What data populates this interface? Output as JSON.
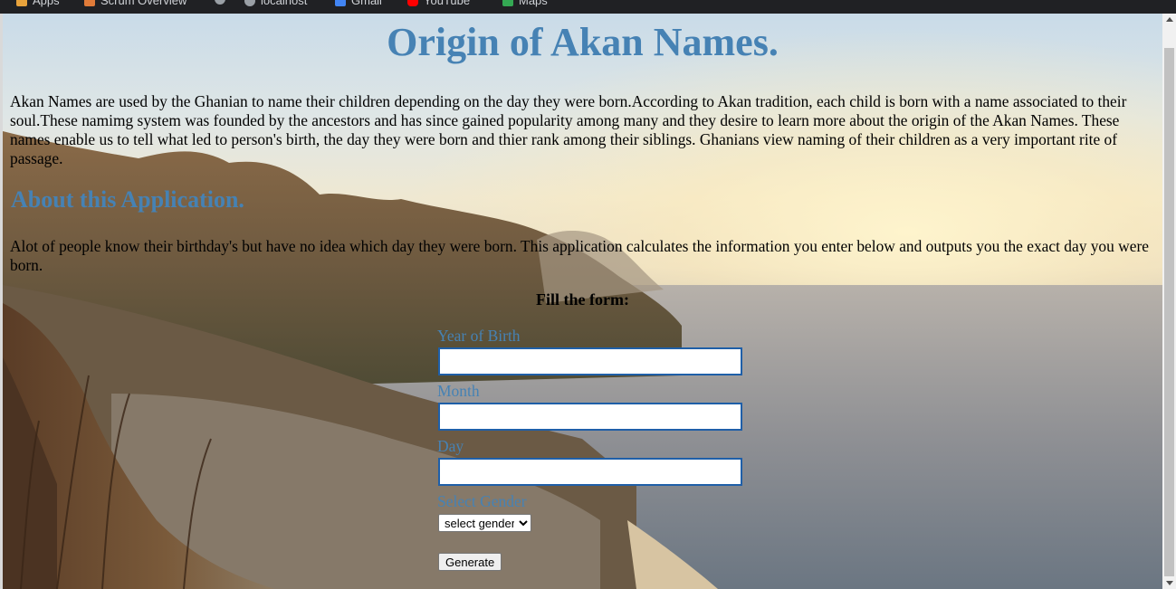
{
  "browser": {
    "bookmarks": [
      {
        "label": "Apps",
        "icon": "apps-grid-icon",
        "color": "#e8a33c"
      },
      {
        "label": "Scrum Overview",
        "icon": "bookmark-page-icon",
        "color": "#e07b39"
      },
      {
        "label": "",
        "icon": "globe-icon",
        "color": "#9aa0a6"
      },
      {
        "label": "localhost",
        "icon": "globe-icon",
        "color": "#9aa0a6"
      },
      {
        "label": "Gmail",
        "icon": "gmail-icon",
        "color": "#4285f4"
      },
      {
        "label": "YouTube",
        "icon": "youtube-icon",
        "color": "#ff0000"
      },
      {
        "label": "Maps",
        "icon": "maps-icon",
        "color": "#34a853"
      }
    ]
  },
  "page": {
    "title": "Origin of Akan Names.",
    "intro": "Akan Names are used by the Ghanian to name their children depending on the day they were born.According to Akan tradition, each child is born with a name associated to their soul.These namimg system was founded by the ancestors and has since gained popularity among many and they desire to learn more about the origin of the Akan Names. These names enable us to tell what led to person's birth, the day they were born and thier rank among their siblings. Ghanians view naming of their children as a very important rite of passage.",
    "about_title": "About this Application.",
    "about_text": "Alot of people know their birthday's but have no idea which day they were born. This application calculates the information you enter below and outputs you the exact day you were born.",
    "accent_color": "#4682b4"
  },
  "form": {
    "heading": "Fill the form:",
    "year_label": "Year of Birth",
    "year_value": "",
    "month_label": "Month",
    "month_value": "",
    "day_label": "Day",
    "day_value": "",
    "gender_label": "Select Gender",
    "gender_selected": "select gender",
    "submit_label": "Generate"
  }
}
